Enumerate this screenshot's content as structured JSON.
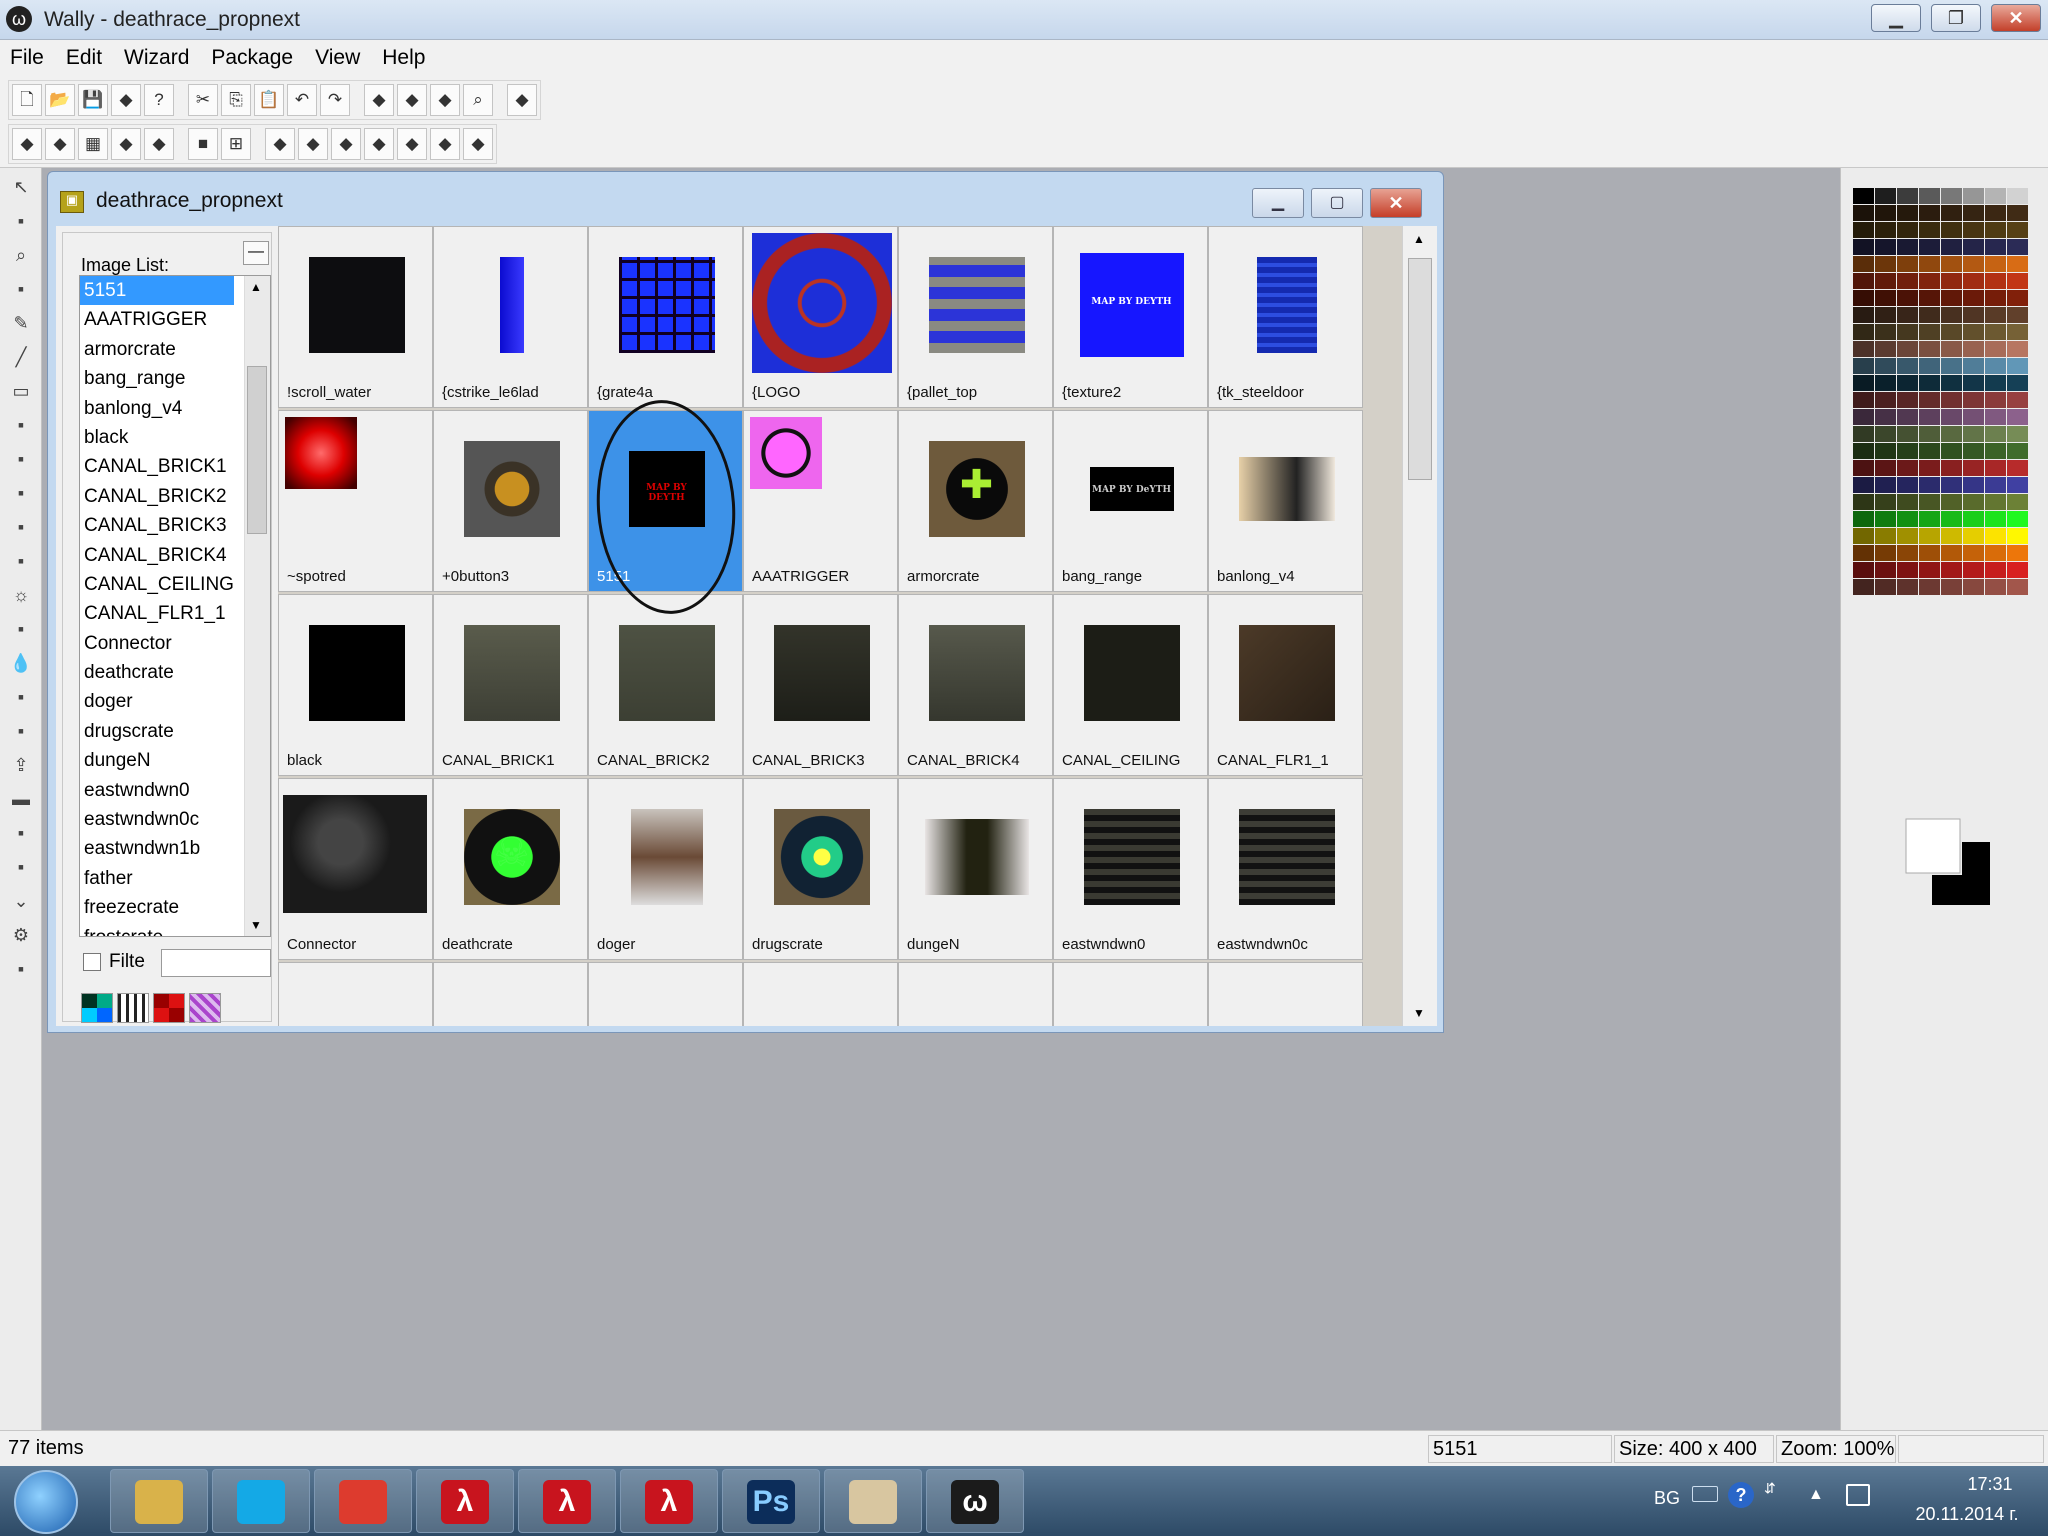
{
  "window": {
    "title": "Wally - deathrace_propnext",
    "app_icon": "wally-logo-icon"
  },
  "menu": [
    "File",
    "Edit",
    "Wizard",
    "Package",
    "View",
    "Help"
  ],
  "toolbar1": [
    "new-icon",
    "open-icon",
    "save-icon",
    "wad-icon",
    "help-icon",
    "|",
    "cut-icon",
    "copy-icon",
    "paste-icon",
    "undo-icon",
    "redo-icon",
    "|",
    "browse-icon",
    "browse-alt-icon",
    "browse-multi-icon",
    "zoom-icon",
    "|",
    "wizard-icon"
  ],
  "toolbar2": [
    "list-view-icon",
    "detail-view-icon",
    "grid-icon",
    "tile-icon",
    "sound-icon",
    "|",
    "color-fill-icon",
    "grid-lines-icon",
    "|",
    "tool-a-icon",
    "tool-b-icon",
    "tool-c-icon",
    "tool-d-icon",
    "tool-e-icon",
    "tool-f-icon",
    "tool-g-icon"
  ],
  "tools": [
    "pointer-icon",
    "ruler-icon",
    "magnifier-icon",
    "eyedropper-icon",
    "pencil-icon",
    "brush-icon",
    "eraser-icon",
    "fill-icon",
    "spray-icon",
    "line-icon",
    "rect-icon",
    "curve-icon",
    "sun-icon",
    "light-icon",
    "drop-icon",
    "filter-icon",
    "stamp-icon",
    "upload-icon",
    "bar-icon",
    "hatch-icon",
    "gun-icon",
    "chevron-icon",
    "gear-icon",
    "misc-icon"
  ],
  "child": {
    "title": "deathrace_propnext"
  },
  "imagelist": {
    "label": "Image List:",
    "items": [
      "5151",
      "AAATRIGGER",
      "armorcrate",
      "bang_range",
      "banlong_v4",
      "black",
      "CANAL_BRICK1",
      "CANAL_BRICK2",
      "CANAL_BRICK3",
      "CANAL_BRICK4",
      "CANAL_CEILING",
      "CANAL_FLR1_1",
      "Connector",
      "deathcrate",
      "doger",
      "drugscrate",
      "dungeN",
      "eastwndwn0",
      "eastwndwn0c",
      "eastwndwn1b",
      "father",
      "freezecrate",
      "frostcrate"
    ],
    "selected": "5151"
  },
  "filter": {
    "label": "Filte",
    "value": ""
  },
  "textures": [
    {
      "name": "!scroll_water"
    },
    {
      "name": "{cstrike_le6lad"
    },
    {
      "name": "{grate4a"
    },
    {
      "name": "{LOGO"
    },
    {
      "name": "{pallet_top"
    },
    {
      "name": "{texture2",
      "text": "MAP BY DEYTH"
    },
    {
      "name": "{tk_steeldoor"
    },
    {
      "name": "~spotred"
    },
    {
      "name": "+0button3"
    },
    {
      "name": "5151",
      "selected": true,
      "text": "MAP BY DEYTH"
    },
    {
      "name": "AAATRIGGER"
    },
    {
      "name": "armorcrate"
    },
    {
      "name": "bang_range",
      "text": "MAP BY DeYTH"
    },
    {
      "name": "banlong_v4"
    },
    {
      "name": "black"
    },
    {
      "name": "CANAL_BRICK1"
    },
    {
      "name": "CANAL_BRICK2"
    },
    {
      "name": "CANAL_BRICK3"
    },
    {
      "name": "CANAL_BRICK4"
    },
    {
      "name": "CANAL_CEILING"
    },
    {
      "name": "CANAL_FLR1_1"
    },
    {
      "name": "Connector"
    },
    {
      "name": "deathcrate"
    },
    {
      "name": "doger"
    },
    {
      "name": "drugscrate"
    },
    {
      "name": "dungeN"
    },
    {
      "name": "eastwndwn0"
    },
    {
      "name": "eastwndwn0c"
    },
    {
      "name": ""
    },
    {
      "name": ""
    },
    {
      "name": ""
    },
    {
      "name": ""
    },
    {
      "name": ""
    },
    {
      "name": ""
    },
    {
      "name": ""
    }
  ],
  "status": {
    "count": "77 items",
    "name": "5151",
    "size": "Size: 400 x 400",
    "zoom": "Zoom: 100%"
  },
  "taskbar": {
    "lang": "BG",
    "time": "17:31",
    "date": "20.11.2014 г.",
    "apps": [
      "explorer-icon",
      "skype-icon",
      "chrome-icon",
      "half-life-icon",
      "half-life-icon",
      "half-life-icon",
      "photoshop-icon",
      "paint-icon",
      "wally-icon"
    ],
    "ps_label": "Ps"
  }
}
